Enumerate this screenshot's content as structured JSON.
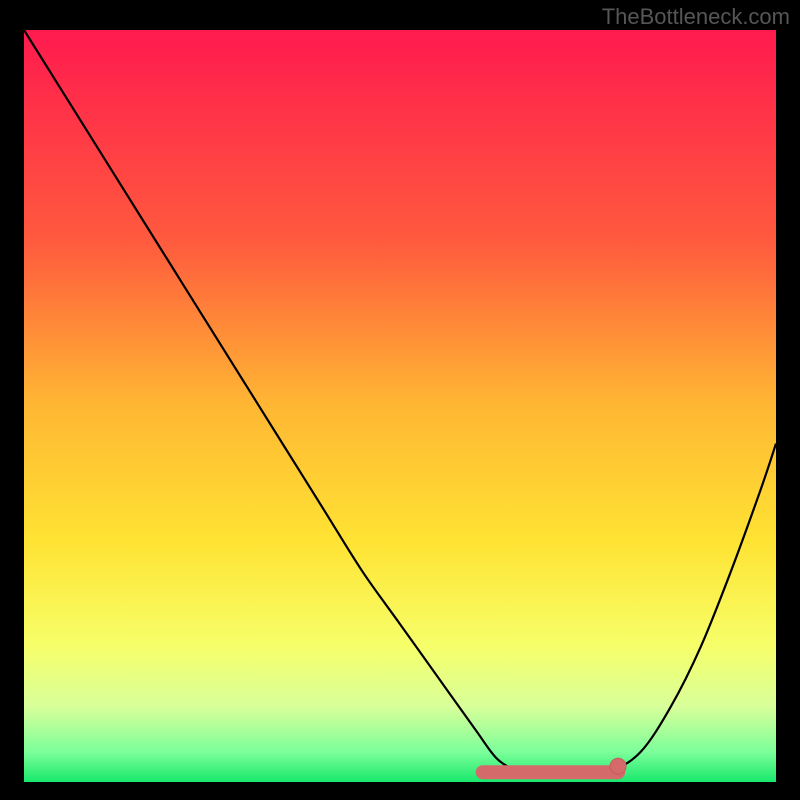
{
  "watermark_text": "TheBottleneck.com",
  "chart_data": {
    "type": "line",
    "title": "",
    "xlabel": "",
    "ylabel": "",
    "x_range": [
      0,
      100
    ],
    "y_range": [
      0,
      100
    ],
    "series": [
      {
        "name": "bottleneck-curve",
        "x": [
          0,
          5,
          10,
          15,
          20,
          25,
          30,
          35,
          40,
          45,
          50,
          55,
          60,
          63,
          66,
          70,
          74,
          78,
          82,
          86,
          90,
          94,
          98,
          100
        ],
        "values": [
          100,
          92,
          84,
          76,
          68,
          60,
          52,
          44,
          36,
          28,
          21,
          14,
          7,
          3,
          1.5,
          1.3,
          1.3,
          1.5,
          4,
          10,
          18,
          28,
          39,
          45
        ]
      }
    ],
    "markers": [
      {
        "name": "optimal-range",
        "x_start": 61,
        "x_end": 79,
        "y": 1.3
      },
      {
        "name": "optimal-point",
        "x": 79,
        "y": 2.1
      }
    ],
    "gradient_stops": [
      {
        "pct": 0,
        "color": "#ff1a4e"
      },
      {
        "pct": 28,
        "color": "#ff5a3e"
      },
      {
        "pct": 50,
        "color": "#ffb733"
      },
      {
        "pct": 68,
        "color": "#ffe333"
      },
      {
        "pct": 82,
        "color": "#f6ff6a"
      },
      {
        "pct": 90,
        "color": "#d8ff9a"
      },
      {
        "pct": 96,
        "color": "#7cff9a"
      },
      {
        "pct": 100,
        "color": "#17e86b"
      }
    ],
    "marker_color": "#d46a6a",
    "marker_stroke": "#c75b5b",
    "curve_color": "#000000"
  }
}
